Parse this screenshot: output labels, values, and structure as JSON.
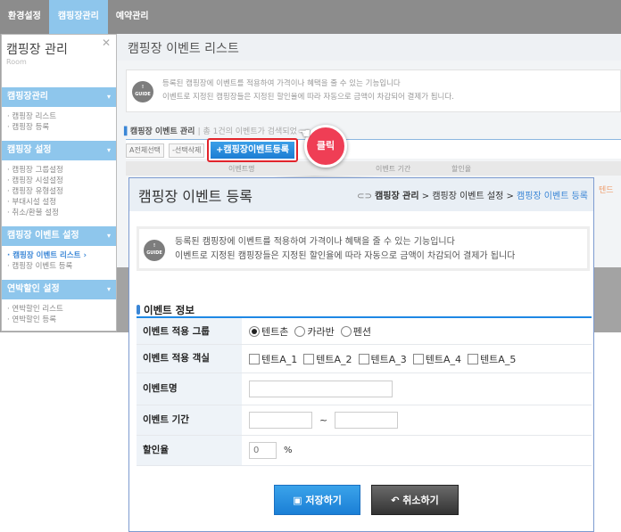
{
  "nav": {
    "tabs": [
      "환경설정",
      "캠핑장관리",
      "예약관리"
    ],
    "active": 1
  },
  "sidebar": {
    "title": "캠핑장 관리",
    "subtitle": "Room",
    "groups": [
      {
        "label": "캠핑장관리",
        "items": [
          "캠핑장 리스트",
          "캠핑장 등록"
        ]
      },
      {
        "label": "캠핑장 설정",
        "items": [
          "캠핑장 그룹설정",
          "캠핑장 시설설정",
          "캠핑장 유형설정",
          "부대시설 설정",
          "취소/환불 설정"
        ]
      },
      {
        "label": "캠핑장 이벤트 설정",
        "items": [
          "캠핑장 이벤트 리스트",
          "캠핑장 이벤트 등록"
        ]
      },
      {
        "label": "연박할인 설정",
        "items": [
          "연박할인 리스트",
          "연박할인 등록"
        ]
      }
    ]
  },
  "main": {
    "title": "캠핑장 이벤트 리스트",
    "guide": [
      "등록된 캠핑장에 이벤트를 적용하여 가격이나 혜택을 줄 수 있는 기능입니다",
      "이벤트로 지정된 캠핑장들은 지정된 할인율에 따라 자동으로 금액이 차감되어 결제가 됩니다."
    ],
    "section": "캠핑장 이벤트 관리",
    "count_text": "총 1건의 이벤트가 검색되었",
    "select_all": "A전체선택",
    "delete_selected": "-선택삭제",
    "register": "+캠핑장이벤트등록",
    "columns": [
      "이벤트명",
      "이벤트 기간",
      "할인율"
    ],
    "peek_text": "텐드"
  },
  "callout": {
    "label": "클릭",
    "accent": "#ef3e55"
  },
  "popup": {
    "title": "캠핑장 이벤트 등록",
    "breadcrumb": [
      "캠핑장 관리",
      "캠핑장 이벤트 설정",
      "캠핑장 이벤트 등록"
    ],
    "guide_icon": "GUIDE",
    "guide": [
      "등록된 캠핑장에 이벤트를 적용하여 가격이나 혜택을 줄 수 있는 기능입니다",
      "이벤트로 지정된 캠핑장들은 지정된 할인율에 따라 자동으로 금액이 차감되어 결제가 됩니다"
    ],
    "section": "이벤트 정보",
    "fields": {
      "group_label": "이벤트 적용 그룹",
      "groups": [
        "텐트촌",
        "카라반",
        "펜션"
      ],
      "group_selected": "텐트촌",
      "rooms_label": "이벤트 적용 객실",
      "rooms": [
        "텐트A_1",
        "텐트A_2",
        "텐트A_3",
        "텐트A_4",
        "텐트A_5"
      ],
      "name_label": "이벤트명",
      "name_value": "",
      "period_label": "이벤트 기간",
      "period_sep": "~",
      "rate_label": "할인율",
      "rate_value": "0",
      "rate_unit": "%"
    },
    "save": "저장하기",
    "cancel": "취소하기",
    "accent": "#1e88e5"
  }
}
